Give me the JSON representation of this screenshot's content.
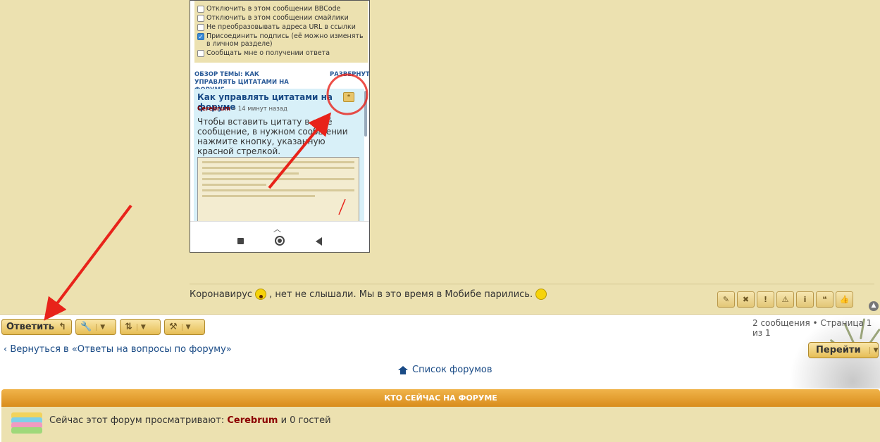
{
  "phone": {
    "options": [
      {
        "label": "Отключить в этом сообщении BBCode",
        "checked": false
      },
      {
        "label": "Отключить в этом сообщении смайлики",
        "checked": false
      },
      {
        "label": "Не преобразовывать адреса URL в ссылки",
        "checked": false
      },
      {
        "label": "Присоединить подпись (её можно изменять в личном разделе)",
        "checked": true
      },
      {
        "label": "Сообщать мне о получении ответа",
        "checked": false
      }
    ],
    "topic_heading": "ОБЗОР ТЕМЫ: КАК УПРАВЛЯТЬ ЦИТАТАМИ НА ФОРУМЕ",
    "topic_heading_right": "РАЗВЕРНУТЬ",
    "quote_title": "Как управлять цитатами на форуме",
    "quote_author": "Cerebrum",
    "quote_time": "» 14 минут назад",
    "quote_text": "Чтобы вставить цитату в своё сообщение, в нужном сообщении нажмите кнопку, указанную красной стрелкой.",
    "quote_icon": "quote-icon"
  },
  "post": {
    "text_before": "Коронавирус",
    "text_after": ", нет не слышали. Мы в это время в Мобибе парились.",
    "tools": [
      {
        "name": "edit-button",
        "icon": "pencil-icon",
        "glyph": "✎"
      },
      {
        "name": "delete-button",
        "icon": "close-icon",
        "glyph": "✖"
      },
      {
        "name": "report-button",
        "icon": "exclamation-icon",
        "glyph": "!"
      },
      {
        "name": "warn-button",
        "icon": "warning-icon",
        "glyph": "⚠"
      },
      {
        "name": "info-button",
        "icon": "info-icon",
        "glyph": "i"
      },
      {
        "name": "quote-button",
        "icon": "quote-icon",
        "glyph": "❝"
      },
      {
        "name": "like-button",
        "icon": "thumbs-up-icon",
        "glyph": "👍"
      }
    ]
  },
  "actions": {
    "reply_label": "Ответить",
    "pagination": "2 сообщения • Страница 1 из 1",
    "back_link": "Вернуться в «Ответы на вопросы по форуму»",
    "goto_label": "Перейти",
    "forum_list": "Список форумов"
  },
  "online": {
    "header": "КТО СЕЙЧАС НА ФОРУМЕ",
    "text_before": "Сейчас этот форум просматривают:",
    "user": "Cerebrum",
    "text_after": "и 0 гостей"
  },
  "colors": {
    "panel_bg": "#ece1b0",
    "button_accent": "#e6bd55",
    "online_header": "#d98c1c",
    "link": "#1a4b86",
    "annotation": "#e8231a"
  }
}
